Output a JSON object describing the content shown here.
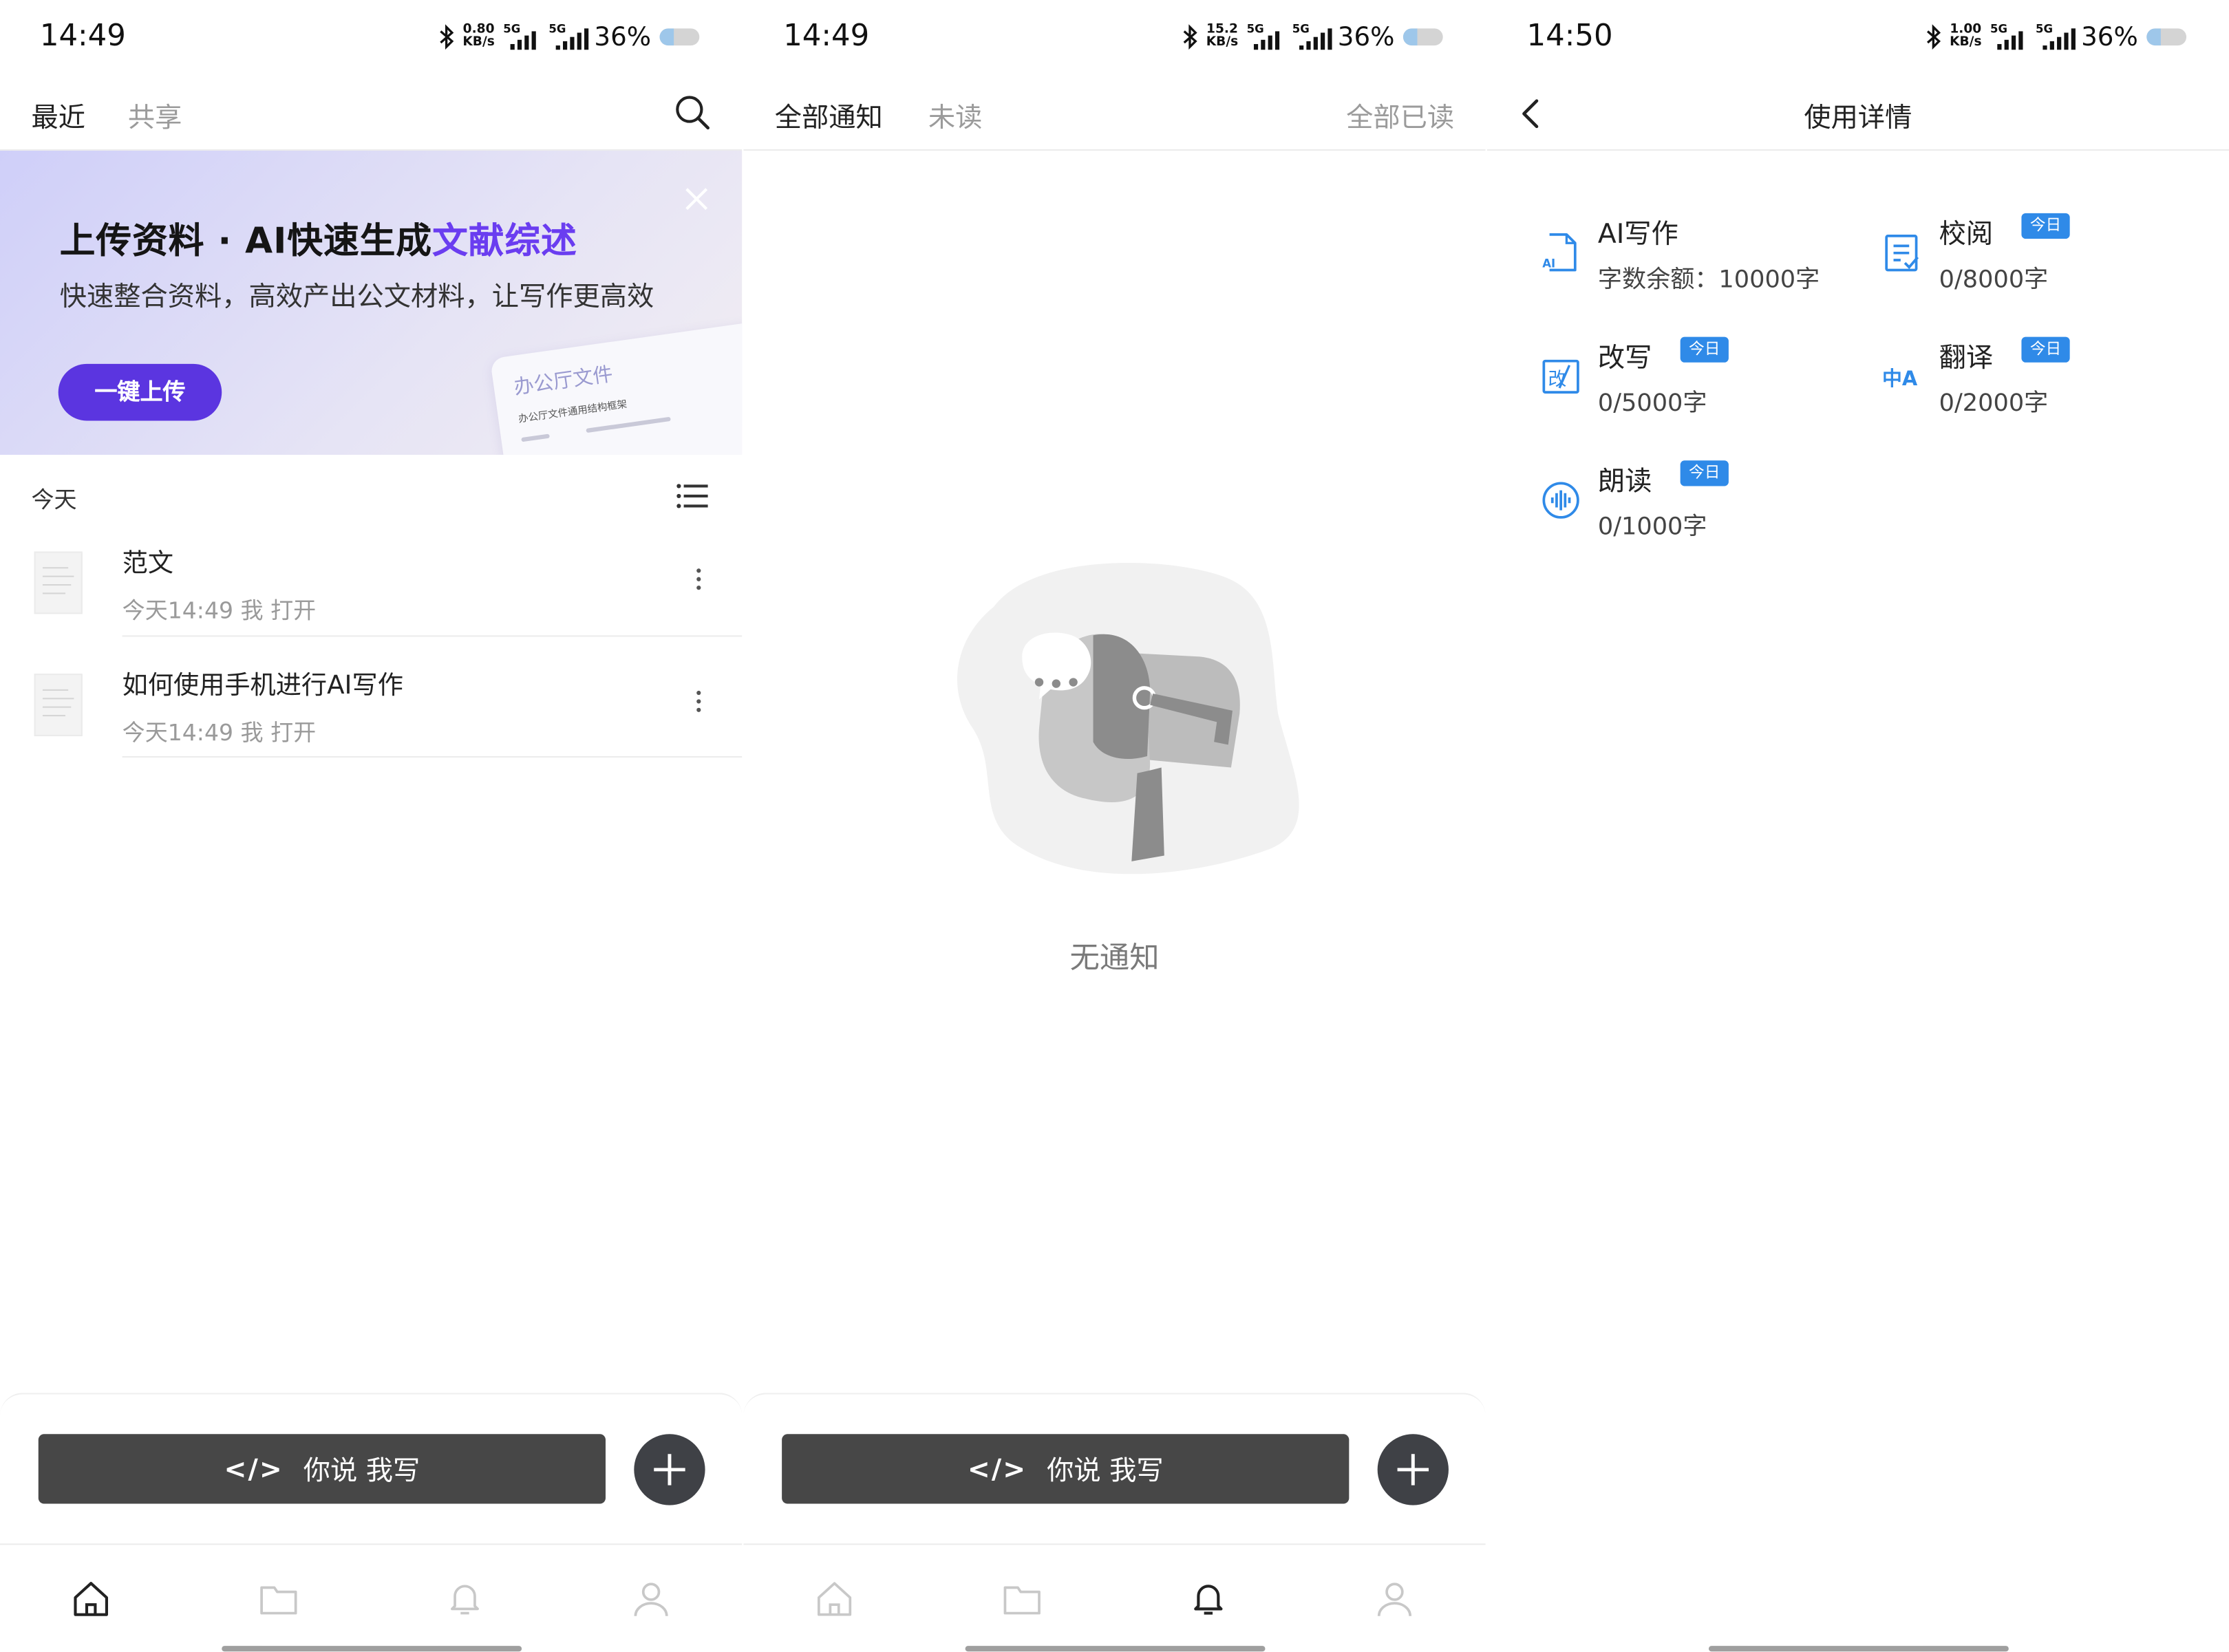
{
  "colors": {
    "accent": "#5b35e0",
    "highlight": "#6a3df0",
    "blue": "#2f8ae8",
    "dark_button": "#474747"
  },
  "panel1": {
    "status": {
      "time": "14:49",
      "speed": "0.80",
      "speed_unit": "KB/s",
      "net1": "5G",
      "net2": "5G",
      "battery": "36%",
      "battery_level": 0.36
    },
    "tabs": [
      {
        "label": "最近"
      },
      {
        "label": "共享"
      }
    ],
    "search_icon": "search-icon",
    "banner": {
      "title_main": "上传资料 · AI快速生成",
      "title_highlight": "文献综述",
      "subtitle": "快速整合资料，高效产出公文材料，让写作更高效",
      "button": "一键上传",
      "card_title": "办公厅文件",
      "card_line": "办公厅文件通用结构框架"
    },
    "section_title": "今天",
    "files": [
      {
        "name": "范文",
        "meta": "今天14:49  我 打开"
      },
      {
        "name": "如何使用手机进行AI写作",
        "meta": "今天14:49  我 打开"
      }
    ],
    "say_button": {
      "glyph": "</>",
      "label": "你说 我写"
    }
  },
  "panel2": {
    "status": {
      "time": "14:49",
      "speed": "15.2",
      "speed_unit": "KB/s",
      "net1": "5G",
      "net2": "5G",
      "battery": "36%",
      "battery_level": 0.36
    },
    "tabs": [
      {
        "label": "全部通知"
      },
      {
        "label": "未读"
      }
    ],
    "read_all": "全部已读",
    "empty_text": "无通知",
    "say_button": {
      "glyph": "</>",
      "label": "你说 我写"
    }
  },
  "panel3": {
    "status": {
      "time": "14:50",
      "speed": "1.00",
      "speed_unit": "KB/s",
      "net1": "5G",
      "net2": "5G",
      "battery": "36%",
      "battery_level": 0.36
    },
    "title": "使用详情",
    "items": [
      {
        "label": "AI写作",
        "value": "字数余额：10000字",
        "badge": "",
        "icon": "ai-doc-icon"
      },
      {
        "label": "校阅",
        "value": "0/8000字",
        "badge": "今日",
        "icon": "proofread-icon"
      },
      {
        "label": "改写",
        "value": "0/5000字",
        "badge": "今日",
        "icon": "rewrite-icon"
      },
      {
        "label": "翻译",
        "value": "0/2000字",
        "badge": "今日",
        "icon": "translate-icon"
      },
      {
        "label": "朗读",
        "value": "0/1000字",
        "badge": "今日",
        "icon": "voice-icon"
      }
    ],
    "ai_icon_text": "AI",
    "rewrite_icon_text": "改",
    "translate_icon_text": "中A"
  }
}
